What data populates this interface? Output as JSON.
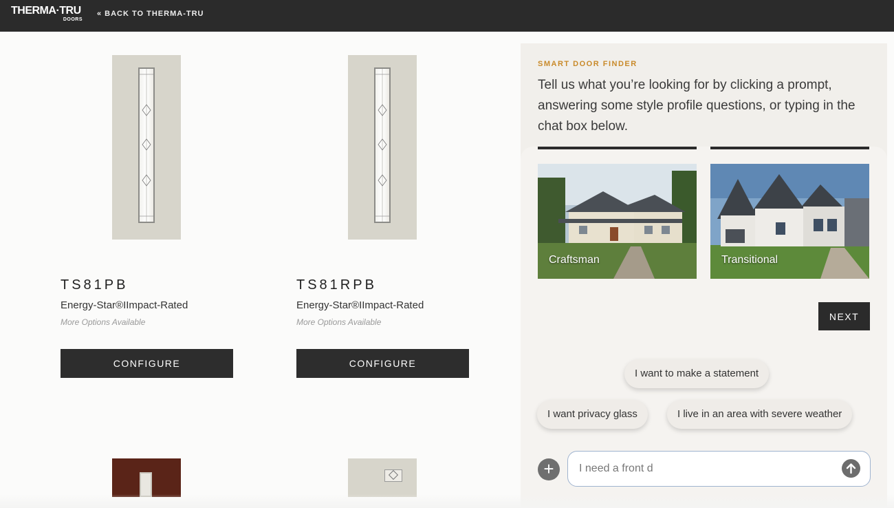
{
  "header": {
    "logo_main": "THERMA·TRU",
    "logo_sub": "DOORS",
    "back_link": "« BACK TO THERMA-TRU"
  },
  "products": [
    {
      "title": "TS81PB",
      "subtitle": "Energy-Star®IImpact-Rated",
      "more": "More Options Available",
      "configure_label": "CONFIGURE"
    },
    {
      "title": "TS81RPB",
      "subtitle": "Energy-Star®IImpact-Rated",
      "more": "More Options Available",
      "configure_label": "CONFIGURE"
    }
  ],
  "finder": {
    "label": "SMART DOOR FINDER",
    "description": "Tell us what you’re looking for by clicking a prompt, answering some style profile questions, or typing in the chat box below.",
    "styles": [
      {
        "label": "Craftsman"
      },
      {
        "label": "Transitional"
      }
    ],
    "next_label": "NEXT",
    "prompts": [
      "I want to make a statement",
      "I want privacy glass",
      "I live in an area with severe weather"
    ],
    "chat": {
      "value": "I need a front d",
      "plus_icon": "plus-icon",
      "send_icon": "arrow-up-icon"
    }
  },
  "colors": {
    "topbar": "#2b2b2b",
    "accent": "#c98a2a",
    "panel": "#f1efeb",
    "button": "#2d2d2d"
  }
}
